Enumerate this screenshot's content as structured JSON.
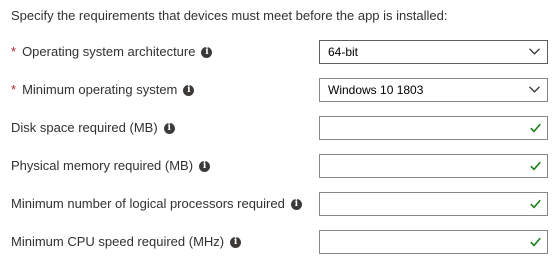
{
  "heading": "Specify the requirements that devices must meet before the app is installed:",
  "required_marker": "*",
  "info_glyph": "i",
  "colors": {
    "required": "#a4262c",
    "check": "#107c10",
    "border": "#8a8886"
  },
  "fields": {
    "os_architecture": {
      "label": "Operating system architecture",
      "required": true,
      "type": "dropdown",
      "value": "64-bit"
    },
    "min_os": {
      "label": "Minimum operating system",
      "required": true,
      "type": "dropdown",
      "value": "Windows 10 1803"
    },
    "disk_space": {
      "label": "Disk space required (MB)",
      "required": false,
      "type": "text",
      "value": ""
    },
    "physical_memory": {
      "label": "Physical memory required (MB)",
      "required": false,
      "type": "text",
      "value": ""
    },
    "logical_processors": {
      "label": "Minimum number of logical processors required",
      "required": false,
      "type": "text",
      "value": ""
    },
    "cpu_speed": {
      "label": "Minimum CPU speed required (MHz)",
      "required": false,
      "type": "text",
      "value": ""
    }
  },
  "icons": {
    "info": "info-icon",
    "chevron": "chevron-down-icon",
    "check": "checkmark-icon"
  }
}
